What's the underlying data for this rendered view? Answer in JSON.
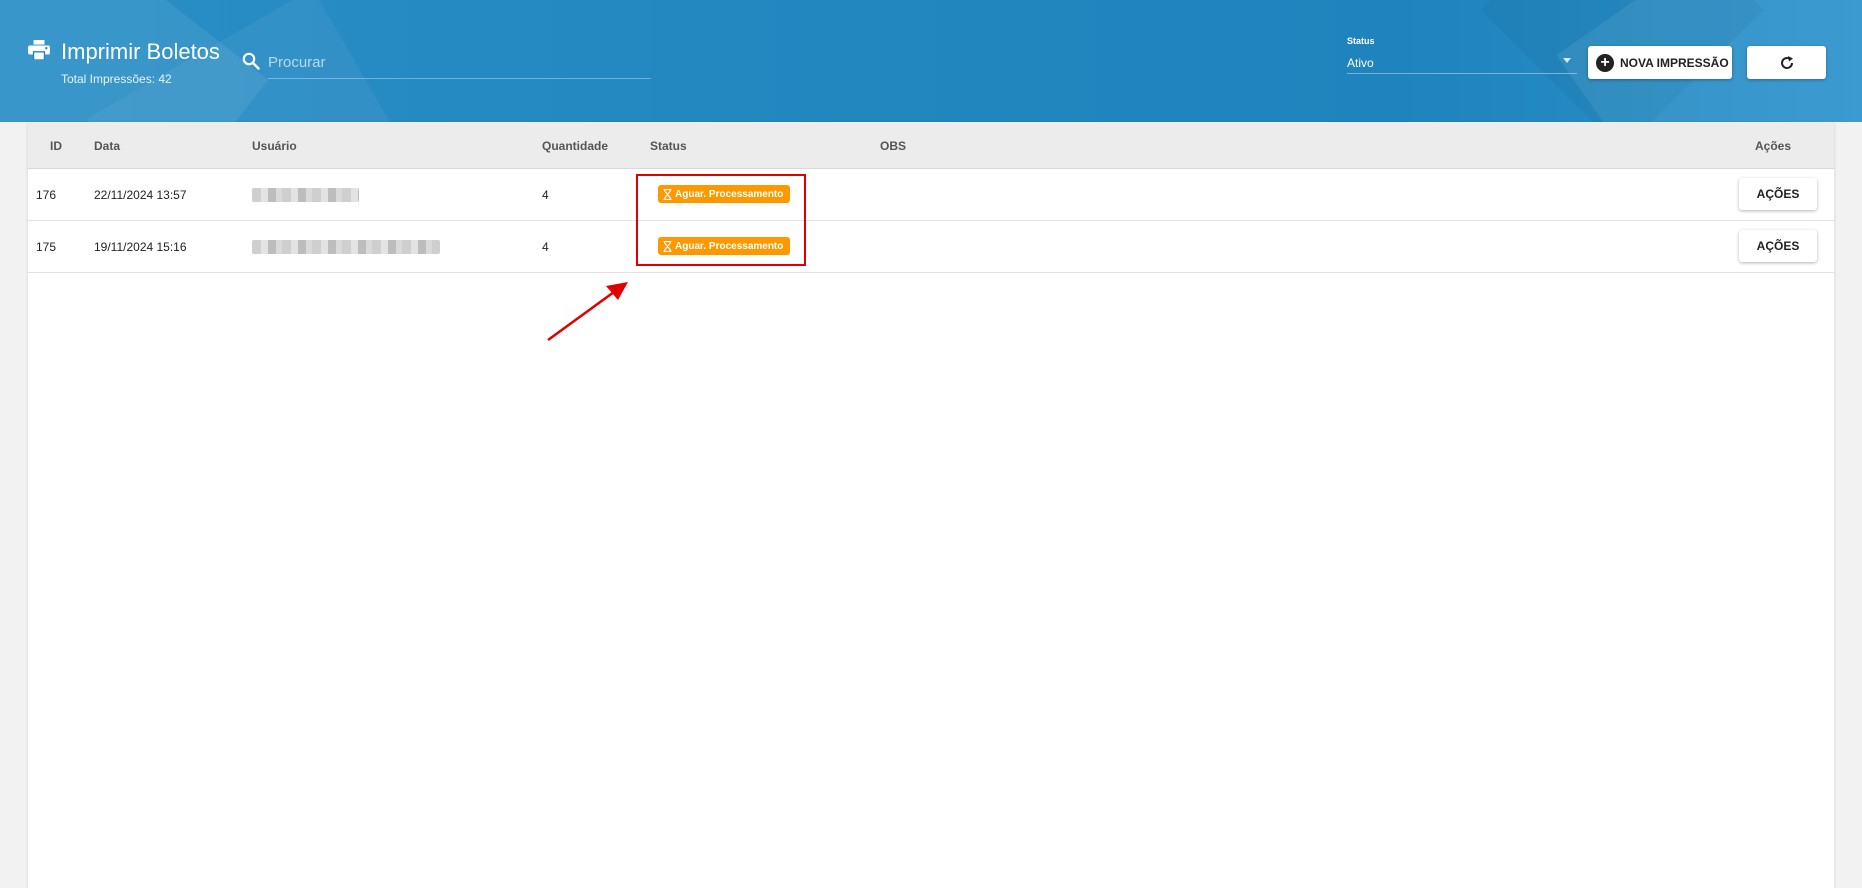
{
  "header": {
    "title": "Imprimir Boletos",
    "total_label": "Total Impressões: 42",
    "search_placeholder": "Procurar",
    "status_filter": {
      "label": "Status",
      "value": "Ativo"
    },
    "new_button_label": "NOVA IMPRESSÃO",
    "icons": {
      "print": "printer-icon",
      "search": "search-icon",
      "add": "plus-circle-icon",
      "refresh": "refresh-icon",
      "caret": "caret-down-icon"
    }
  },
  "table": {
    "columns": [
      "ID",
      "Data",
      "Usuário",
      "Quantidade",
      "Status",
      "OBS",
      "Ações"
    ],
    "rows": [
      {
        "id": "176",
        "date": "22/11/2024 13:57",
        "user": "",
        "quantity": "4",
        "status": "Aguar. Processamento",
        "obs": "",
        "action_label": "AÇÕES"
      },
      {
        "id": "175",
        "date": "19/11/2024 15:16",
        "user": "",
        "quantity": "4",
        "status": "Aguar. Processamento",
        "obs": "",
        "action_label": "AÇÕES"
      }
    ]
  },
  "colors": {
    "header_blue": "#2286bf",
    "badge_orange": "#fe9800",
    "annotation_red": "#e00000"
  }
}
